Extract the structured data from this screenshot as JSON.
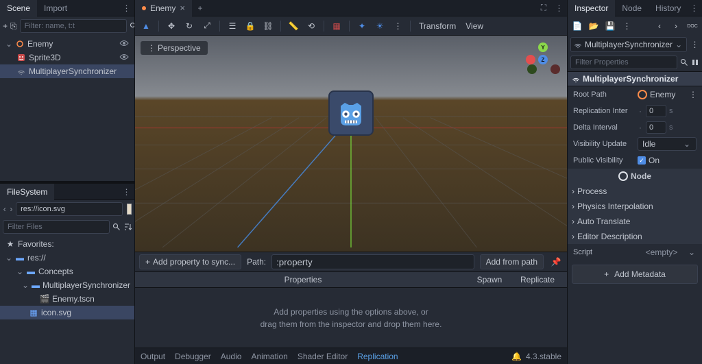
{
  "left": {
    "tabs": {
      "scene": "Scene",
      "import": "Import"
    },
    "toolbar": {
      "filter_placeholder": "Filter: name, t:t"
    },
    "tree": {
      "root": "Enemy",
      "sprite": "Sprite3D",
      "sync": "MultiplayerSynchronizer"
    },
    "filesystem": {
      "title": "FileSystem",
      "path": "res://icon.svg",
      "filter_files": "Filter Files",
      "favorites": "Favorites:",
      "res": "res://",
      "concepts": "Concepts",
      "mult": "MultiplayerSynchronizer",
      "enemy_scn": "Enemy.tscn",
      "icon_svg": "icon.svg"
    }
  },
  "center": {
    "tab_name": "Enemy",
    "perspective": "Perspective",
    "menus": {
      "transform": "Transform",
      "view": "View"
    },
    "sync": {
      "add_prop": "Add property to sync...",
      "path_label": "Path:",
      "path_value": ":property",
      "add_from_path": "Add from path",
      "hdr_props": "Properties",
      "hdr_spawn": "Spawn",
      "hdr_replicate": "Replicate",
      "empty1": "Add properties using the options above, or",
      "empty2": "drag them from the inspector and drop them here."
    },
    "bottom": {
      "output": "Output",
      "debugger": "Debugger",
      "audio": "Audio",
      "animation": "Animation",
      "shader": "Shader Editor",
      "replication": "Replication",
      "version": "4.3.stable"
    }
  },
  "right": {
    "tabs": {
      "inspector": "Inspector",
      "node": "Node",
      "history": "History"
    },
    "selected_node": "MultiplayerSynchronizer",
    "filter_props": "Filter Properties",
    "class_hdr": "MultiplayerSynchronizer",
    "root_path_label": "Root Path",
    "root_path_value": "Enemy",
    "repl_inter_label": "Replication Inter",
    "repl_inter_val": "0",
    "repl_inter_unit": "s",
    "delta_int_label": "Delta Interval",
    "delta_int_val": "0",
    "delta_int_unit": "s",
    "vis_update_label": "Visibility Update",
    "vis_update_val": "Idle",
    "pub_vis_label": "Public Visibility",
    "pub_vis_val": "On",
    "node_hdr": "Node",
    "process": "Process",
    "phys_interp": "Physics Interpolation",
    "auto_translate": "Auto Translate",
    "editor_desc": "Editor Description",
    "script_label": "Script",
    "script_val": "<empty>",
    "add_metadata": "Add Metadata",
    "doc_icon": "DOC"
  }
}
